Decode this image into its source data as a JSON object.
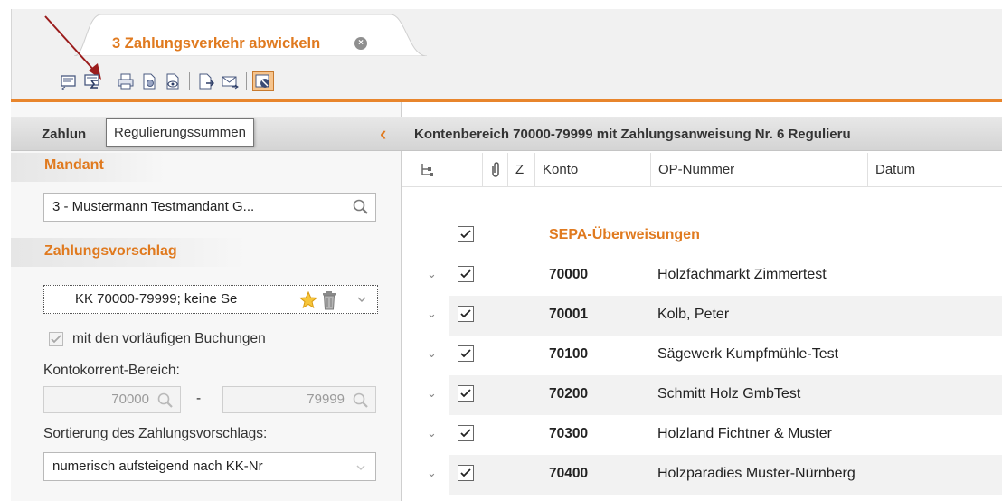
{
  "tab": {
    "title": "3 Zahlungsverkehr abwickeln",
    "close_glyph": "×"
  },
  "toolbar": {
    "buttons": [
      {
        "icon": "transfer-list-icon"
      },
      {
        "icon": "sum-icon"
      },
      {
        "icon": "printer-icon"
      },
      {
        "icon": "print-settings-icon"
      },
      {
        "icon": "print-preview-icon"
      },
      {
        "icon": "export-icon"
      },
      {
        "icon": "email-icon"
      },
      {
        "icon": "active-filter-icon"
      }
    ]
  },
  "tooltip": {
    "text": "Regulierungssummen"
  },
  "left_panel": {
    "title": "Zahlun",
    "collapse_glyph": "‹",
    "mandant_label": "Mandant",
    "mandant_value": "3 - Mustermann Testmandant G...",
    "vorschlag_label": "Zahlungsvorschlag",
    "vorschlag_value": "KK 70000-79999; keine Se",
    "vorlaeufig_label": "mit den vorläufigen Buchungen",
    "bereich_label": "Kontokorrent-Bereich:",
    "bereich_from": "70000",
    "bereich_sep": "-",
    "bereich_to": "79999",
    "sort_label": "Sortierung des Zahlungsvorschlags:",
    "sort_value": "numerisch aufsteigend nach KK-Nr"
  },
  "right_panel": {
    "title": "Kontenbereich 70000-79999 mit Zahlungsanweisung Nr. 6 Regulieru",
    "columns": {
      "z": "Z",
      "konto": "Konto",
      "op": "OP-Nummer",
      "datum": "Datum"
    },
    "group_label": "SEPA-Überweisungen",
    "rows": [
      {
        "konto": "70000",
        "name": "Holzfachmarkt Zimmertest"
      },
      {
        "konto": "70001",
        "name": "Kolb, Peter"
      },
      {
        "konto": "70100",
        "name": "Sägewerk Kumpfmühle-Test"
      },
      {
        "konto": "70200",
        "name": "Schmitt Holz GmbTest"
      },
      {
        "konto": "70300",
        "name": "Holzland Fichtner & Muster"
      },
      {
        "konto": "70400",
        "name": "Holzparadies Muster-Nürnberg"
      }
    ]
  },
  "colors": {
    "accent": "#e07a1f",
    "tab_line": "#e8852c",
    "arrow": "#9b1c1c"
  }
}
